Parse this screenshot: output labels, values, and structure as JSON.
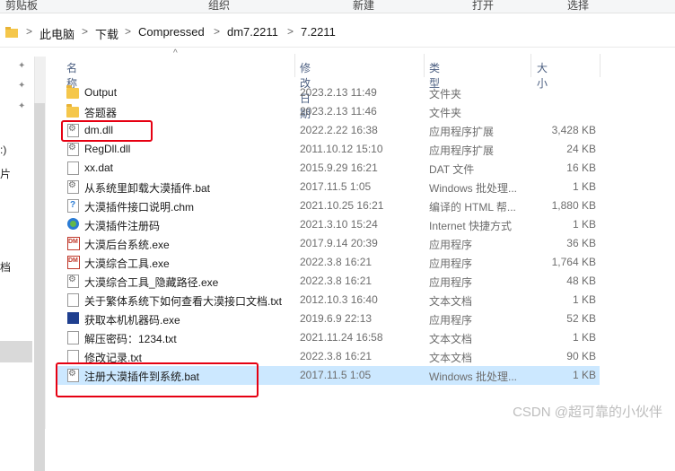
{
  "ribbon": {
    "items": [
      "剪贴板",
      "组织",
      "新建",
      "打开",
      "选择"
    ]
  },
  "address": {
    "crumbs": [
      "此电脑",
      "下载",
      "Compressed",
      "dm7.2211",
      "7.2211"
    ],
    "sep": ">"
  },
  "nav": {
    "fragments": [
      ":)",
      "片",
      "档"
    ]
  },
  "columns": {
    "name": "名称",
    "date": "修改日期",
    "type": "类型",
    "size": "大小",
    "sort_arrow": "^"
  },
  "files": [
    {
      "name": "Output",
      "date": "2023.2.13 11:49",
      "type": "文件夹",
      "size": "",
      "icon": "folder-icon"
    },
    {
      "name": "答题器",
      "date": "2023.2.13 11:46",
      "type": "文件夹",
      "size": "",
      "icon": "folder-icon"
    },
    {
      "name": "dm.dll",
      "date": "2022.2.22 16:38",
      "type": "应用程序扩展",
      "size": "3,428 KB",
      "icon": "dll-icon"
    },
    {
      "name": "RegDll.dll",
      "date": "2011.10.12 15:10",
      "type": "应用程序扩展",
      "size": "24 KB",
      "icon": "dll-icon"
    },
    {
      "name": "xx.dat",
      "date": "2015.9.29 16:21",
      "type": "DAT 文件",
      "size": "16 KB",
      "icon": "file-icon"
    },
    {
      "name": "从系统里卸载大漠插件.bat",
      "date": "2017.11.5 1:05",
      "type": "Windows 批处理...",
      "size": "1 KB",
      "icon": "bat-icon"
    },
    {
      "name": "大漠插件接口说明.chm",
      "date": "2021.10.25 16:21",
      "type": "编译的 HTML 帮...",
      "size": "1,880 KB",
      "icon": "chm-icon"
    },
    {
      "name": "大漠插件注册码",
      "date": "2021.3.10 15:24",
      "type": "Internet 快捷方式",
      "size": "1 KB",
      "icon": "url-shortcut-icon"
    },
    {
      "name": "大漠后台系统.exe",
      "date": "2017.9.14 20:39",
      "type": "应用程序",
      "size": "36 KB",
      "icon": "dm-app-icon"
    },
    {
      "name": "大漠综合工具.exe",
      "date": "2022.3.8 16:21",
      "type": "应用程序",
      "size": "1,764 KB",
      "icon": "dm-app-icon"
    },
    {
      "name": "大漠综合工具_隐藏路径.exe",
      "date": "2022.3.8 16:21",
      "type": "应用程序",
      "size": "48 KB",
      "icon": "gear-app-icon"
    },
    {
      "name": "关于繁体系统下如何查看大漠接口文档.txt",
      "date": "2012.10.3 16:40",
      "type": "文本文档",
      "size": "1 KB",
      "icon": "text-file-icon"
    },
    {
      "name": "获取本机机器码.exe",
      "date": "2019.6.9 22:13",
      "type": "应用程序",
      "size": "52 KB",
      "icon": "machine-code-app-icon"
    },
    {
      "name": "解压密码：1234.txt",
      "date": "2021.11.24 16:58",
      "type": "文本文档",
      "size": "1 KB",
      "icon": "text-file-icon"
    },
    {
      "name": "修改记录.txt",
      "date": "2022.3.8 16:21",
      "type": "文本文档",
      "size": "90 KB",
      "icon": "text-file-icon"
    },
    {
      "name": "注册大漠插件到系统.bat",
      "date": "2017.11.5 1:05",
      "type": "Windows 批处理...",
      "size": "1 KB",
      "icon": "bat-icon"
    }
  ],
  "watermark": "CSDN @超可靠的小伙伴",
  "colors": {
    "selection": "#cce8ff",
    "highlight_box": "#e60012",
    "header_text": "#4d6082"
  }
}
